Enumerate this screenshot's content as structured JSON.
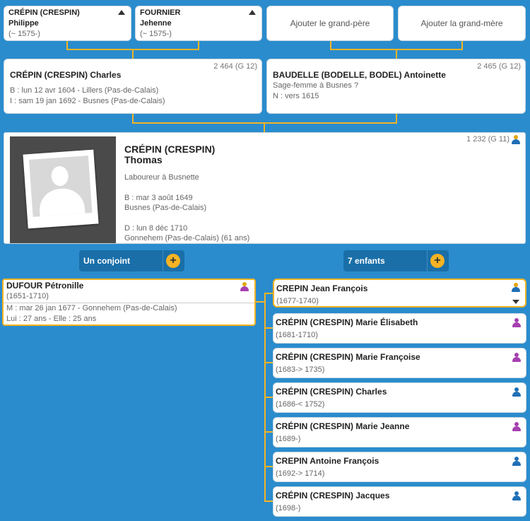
{
  "grandparents": [
    {
      "last": "CRÉPIN (CRESPIN)",
      "first": "Philippe",
      "dates": "(~ 1575-)"
    },
    {
      "last": "FOURNIER",
      "first": "Jehenne",
      "dates": "(~ 1575-)"
    }
  ],
  "add_grandfather": "Ajouter le grand-père",
  "add_grandmother": "Ajouter la grand-mère",
  "father": {
    "id": "2 464 (G 12)",
    "name": "CRÉPIN (CRESPIN) Charles",
    "line1": "B : lun 12 avr 1604 - Lillers (Pas-de-Calais)",
    "line2": "I : sam 19 jan 1692 - Busnes (Pas-de-Calais)"
  },
  "mother": {
    "id": "2 465 (G 12)",
    "name": "BAUDELLE (BODELLE, BODEL) Antoinette",
    "line1": "Sage-femme à Busnes ?",
    "line2": "N : vers 1615"
  },
  "main": {
    "id": "1 232 (G 11)",
    "last": "CRÉPIN (CRESPIN)",
    "first": "Thomas",
    "occupation": "Laboureur à Busnette",
    "birth": "B : mar 3 août 1649",
    "birth_place": "Busnes (Pas-de-Calais)",
    "death": "D : lun 8 déc 1710",
    "death_place": "Gonnehem (Pas-de-Calais) (61 ans)"
  },
  "spouse_button": "Un conjoint",
  "children_button": "7 enfants",
  "spouse": {
    "name": "DUFOUR Pétronille",
    "dates": "(1651-1710)",
    "marriage": "M : mar 26 jan 1677 - Gonnehem (Pas-de-Calais)",
    "ages": "Lui : 27 ans - Elle : 25 ans"
  },
  "children": [
    {
      "name": "CREPIN Jean François",
      "dates": "(1677-1740)",
      "sex": "m"
    },
    {
      "name": "CRÉPIN (CRESPIN) Marie Élisabeth",
      "dates": "(1681-1710)",
      "sex": "f"
    },
    {
      "name": "CRÉPIN (CRESPIN) Marie Françoise",
      "dates": "(1683-> 1735)",
      "sex": "f"
    },
    {
      "name": "CRÉPIN (CRESPIN) Charles",
      "dates": "(1686-< 1752)",
      "sex": "m"
    },
    {
      "name": "CRÉPIN (CRESPIN) Marie Jeanne",
      "dates": "(1689-)",
      "sex": "f"
    },
    {
      "name": "CREPIN Antoine François",
      "dates": "(1692-> 1714)",
      "sex": "m"
    },
    {
      "name": "CRÉPIN (CRESPIN) Jacques",
      "dates": "(1698-)",
      "sex": "m"
    }
  ],
  "colors": {
    "background": "#2a8ccd",
    "accent": "#f5b324",
    "male": "#1f6fb5",
    "female": "#a63fb0",
    "selected": "#e2a612"
  }
}
